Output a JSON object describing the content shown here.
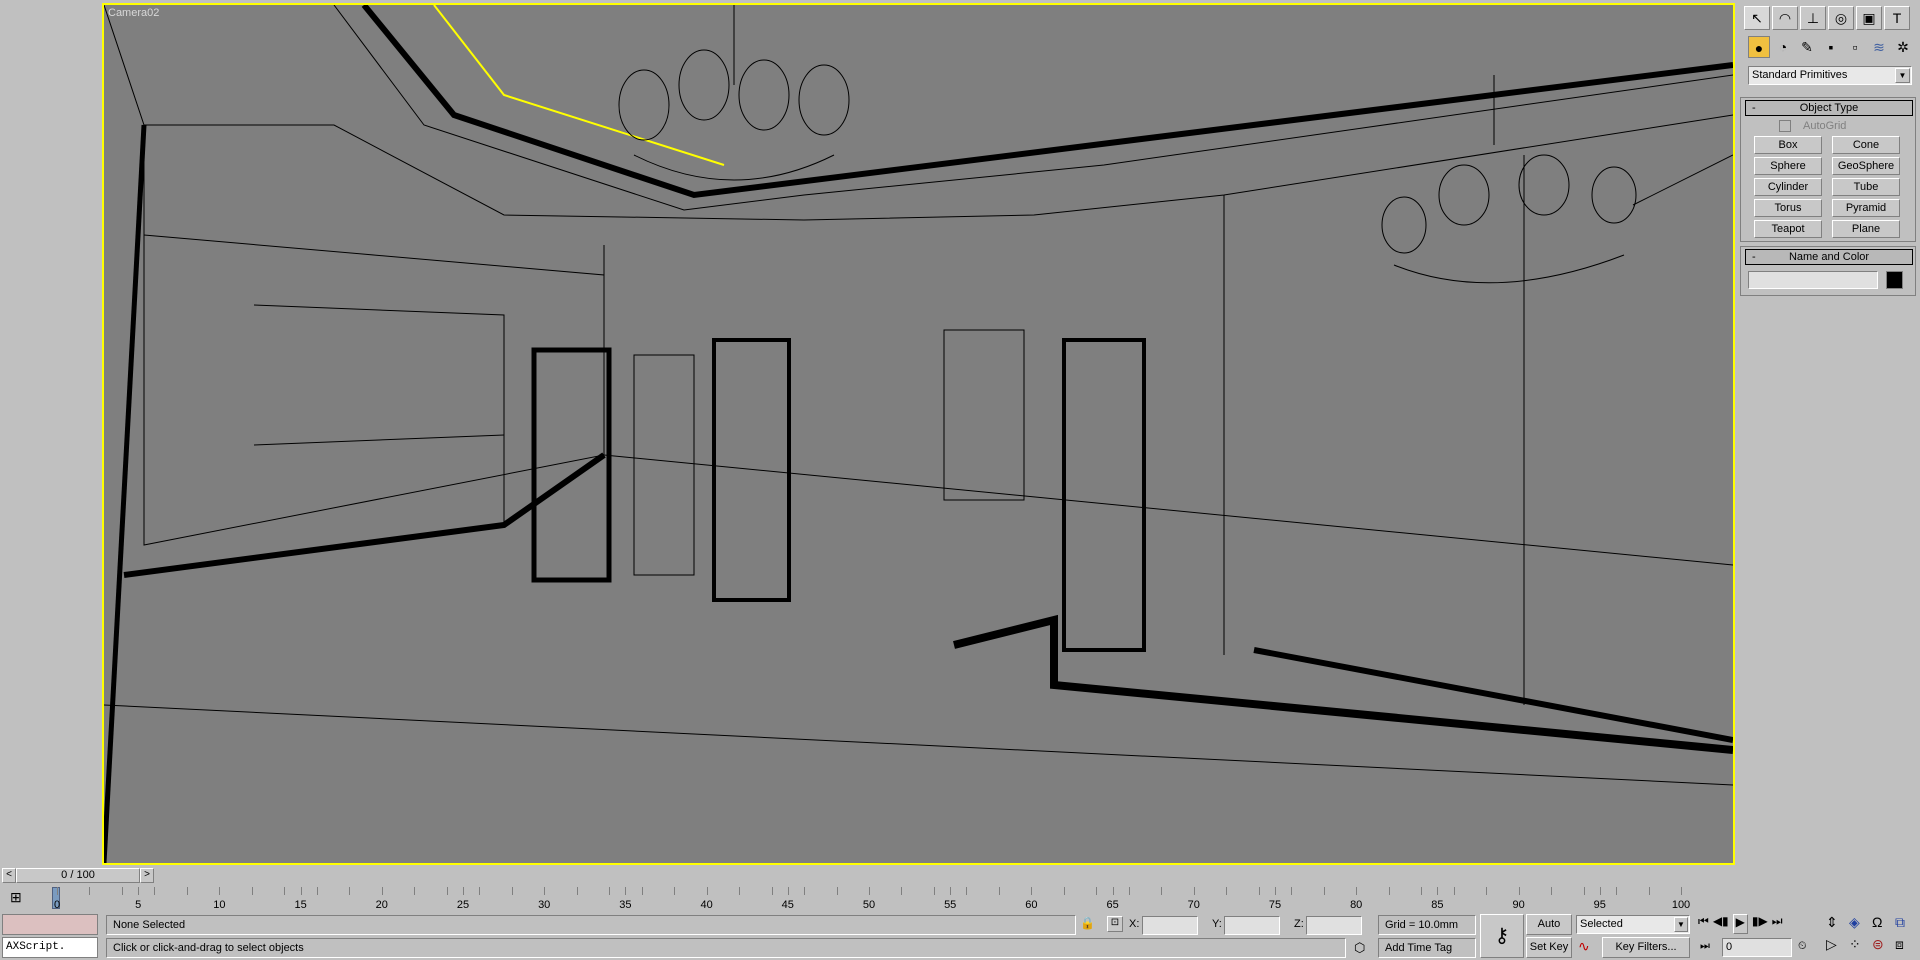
{
  "viewport": {
    "label": "Camera02"
  },
  "command_panel": {
    "tabs": [
      "create-icon",
      "modify-icon",
      "hierarchy-icon",
      "motion-icon",
      "display-icon",
      "utilities-icon"
    ],
    "categories": [
      "geometry-icon",
      "shapes-icon",
      "lights-icon",
      "cameras-icon",
      "helpers-icon",
      "space-warps-icon",
      "systems-icon"
    ],
    "dropdown": "Standard Primitives",
    "object_type": {
      "title": "Object Type",
      "autogrid": "AutoGrid",
      "buttons": [
        "Box",
        "Cone",
        "Sphere",
        "GeoSphere",
        "Cylinder",
        "Tube",
        "Torus",
        "Pyramid",
        "Teapot",
        "Plane"
      ]
    },
    "name_color": {
      "title": "Name and Color",
      "name_value": "",
      "color": "#000000"
    },
    "collapse": "-"
  },
  "time_slider": {
    "value": "0 / 100",
    "prev": "<",
    "next": ">",
    "current_frame": 0,
    "total_frames": 100
  },
  "timeline": {
    "ticks": [
      "0",
      "5",
      "10",
      "15",
      "20",
      "25",
      "30",
      "35",
      "40",
      "45",
      "50",
      "55",
      "60",
      "65",
      "70",
      "75",
      "80",
      "85",
      "90",
      "95",
      "100"
    ]
  },
  "status": {
    "maxscript": "AXScript.",
    "selection": "None Selected",
    "prompt": "Click or click-and-drag to select objects",
    "x_label": "X:",
    "y_label": "Y:",
    "z_label": "Z:",
    "x": "",
    "y": "",
    "z": "",
    "grid": "Grid = 10.0mm",
    "add_time_tag": "Add Time Tag",
    "auto_key": "Auto Key",
    "set_key": "Set Key",
    "key_mode": "Selected",
    "key_filters": "Key Filters...",
    "frame": "0"
  },
  "colors": {
    "viewport_bg": "#7f7f7f",
    "active_border": "#ffff00",
    "ui_bg": "#c0c0c0",
    "selected_category": "#f0c040"
  }
}
